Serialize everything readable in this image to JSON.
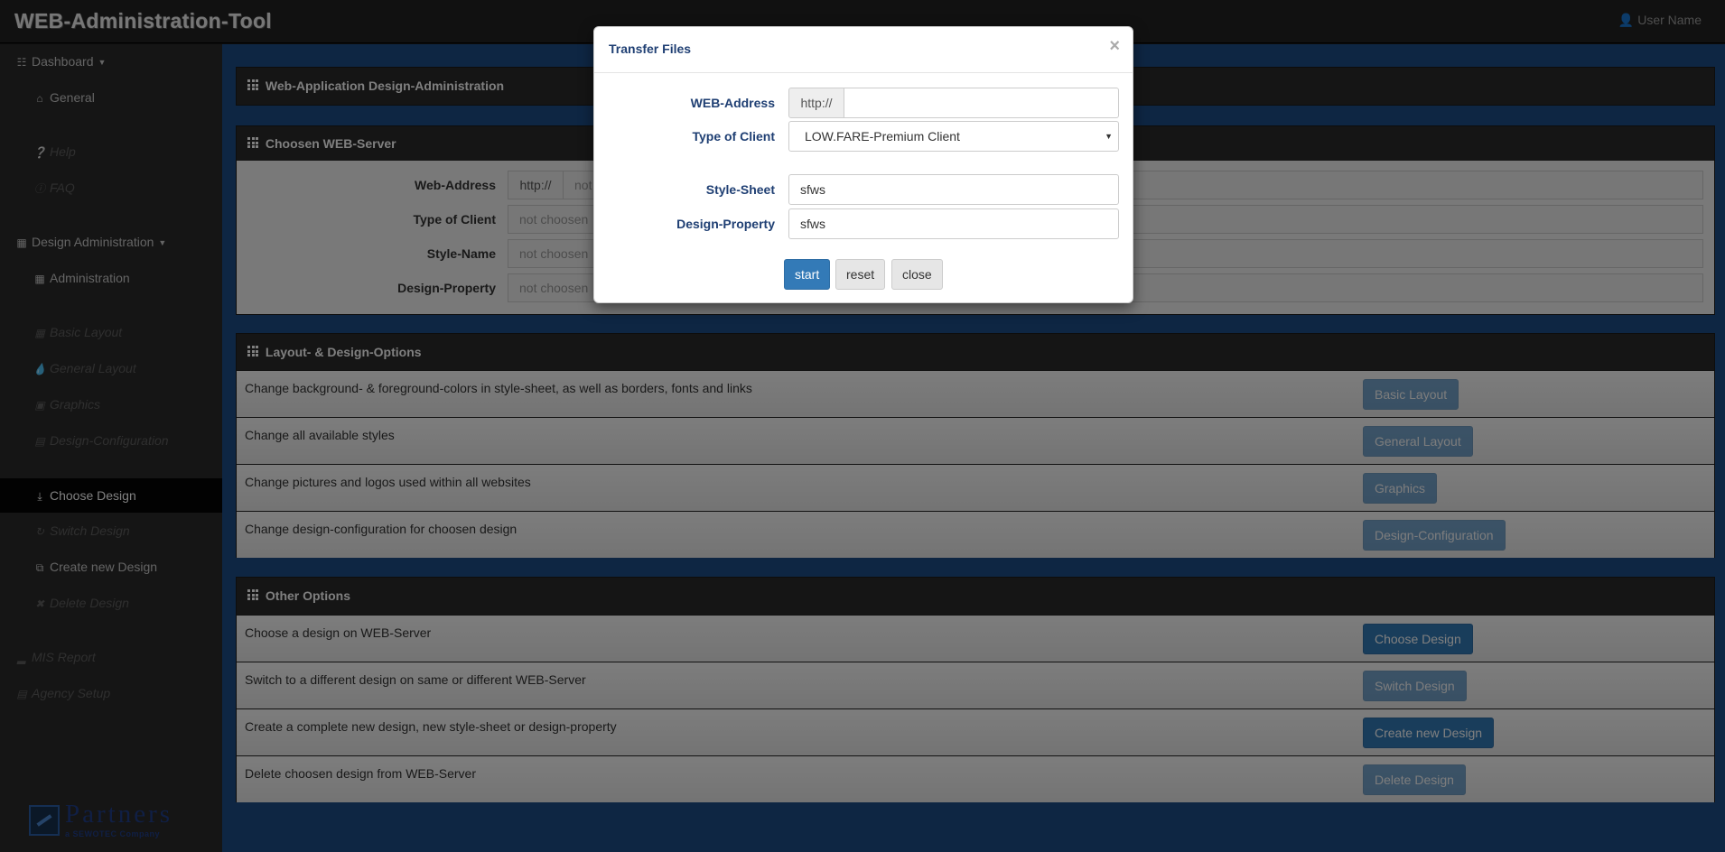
{
  "app": {
    "title": "WEB-Administration-Tool",
    "user": "User Name"
  },
  "sidebar": {
    "dashboard": "Dashboard",
    "general": "General",
    "help": "Help",
    "faq": "FAQ",
    "design_admin": "Design Administration",
    "administration": "Administration",
    "basic_layout": "Basic Layout",
    "general_layout": "General Layout",
    "graphics": "Graphics",
    "design_configuration": "Design-Configuration",
    "choose_design": "Choose Design",
    "switch_design": "Switch Design",
    "create_new_design": "Create new Design",
    "delete_design": "Delete Design",
    "mis_report": "MIS Report",
    "agency_setup": "Agency Setup"
  },
  "logo": {
    "name": "Partners",
    "sub": "a SEWOTEC Company"
  },
  "panels": {
    "app_design": {
      "title": "Web-Application Design-Administration"
    },
    "server": {
      "title": "Choosen WEB-Server",
      "web_address_label": "Web-Address",
      "web_address_prefix": "http://",
      "web_address_value": "not ch",
      "type_label": "Type of Client",
      "type_value": "not choosen",
      "style_label": "Style-Name",
      "style_value": "not choosen",
      "design_label": "Design-Property",
      "design_value": "not choosen"
    },
    "layout": {
      "title": "Layout- & Design-Options",
      "rows": [
        {
          "text": "Change background- & foreground-colors in style-sheet, as well as borders, fonts and links",
          "button": "Basic Layout"
        },
        {
          "text": "Change all available styles",
          "button": "General Layout"
        },
        {
          "text": "Change pictures and logos used within all websites",
          "button": "Graphics"
        },
        {
          "text": "Change design-configuration for choosen design",
          "button": "Design-Configuration"
        }
      ]
    },
    "other": {
      "title": "Other Options",
      "rows": [
        {
          "text": "Choose a design on WEB-Server",
          "button": "Choose Design"
        },
        {
          "text": "Switch to a different design on same or different WEB-Server",
          "button": "Switch Design"
        },
        {
          "text": "Create a complete new design, new style-sheet or design-property",
          "button": "Create new Design"
        },
        {
          "text": "Delete choosen design from WEB-Server",
          "button": "Delete Design"
        }
      ]
    }
  },
  "modal": {
    "title": "Transfer Files",
    "close": "×",
    "web_address_label": "WEB-Address",
    "web_address_prefix": "http://",
    "web_address_value": "",
    "type_label": "Type of Client",
    "type_value": "LOW.FARE-Premium Client",
    "stylesheet_label": "Style-Sheet",
    "stylesheet_value": "sfws",
    "design_label": "Design-Property",
    "design_value": "sfws",
    "buttons": {
      "start": "start",
      "reset": "reset",
      "close": "close"
    }
  },
  "colors": {
    "accent": "#337ab7",
    "modal_label": "#1f3f73",
    "main_bg": "#1c4c86"
  }
}
